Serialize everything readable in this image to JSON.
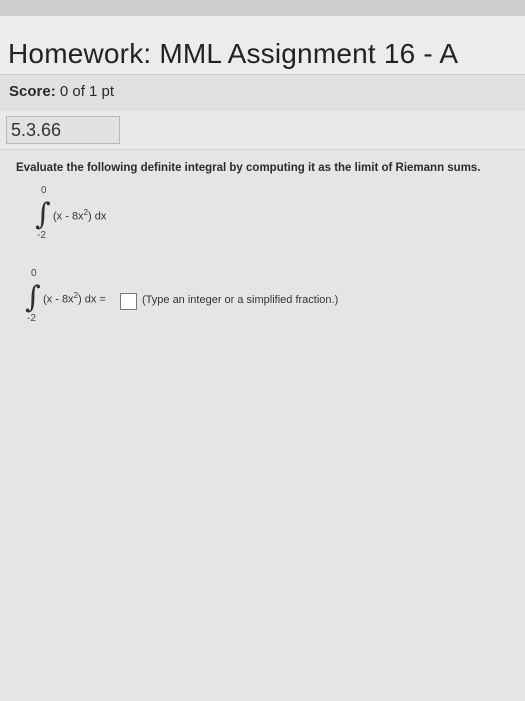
{
  "header": {
    "title": "Homework: MML Assignment 16 - A"
  },
  "score": {
    "label": "Score:",
    "value": "0 of 1 pt"
  },
  "question": {
    "number": "5.3.66",
    "prompt": "Evaluate the following definite integral by computing it as the limit of Riemann sums.",
    "integral": {
      "lower": "-2",
      "upper": "0",
      "integrand": "(x - 8x",
      "exponent": "2",
      "close": ") dx"
    },
    "answer": {
      "equals": " =",
      "value": "",
      "hint": "(Type an integer or a simplified fraction.)"
    }
  }
}
